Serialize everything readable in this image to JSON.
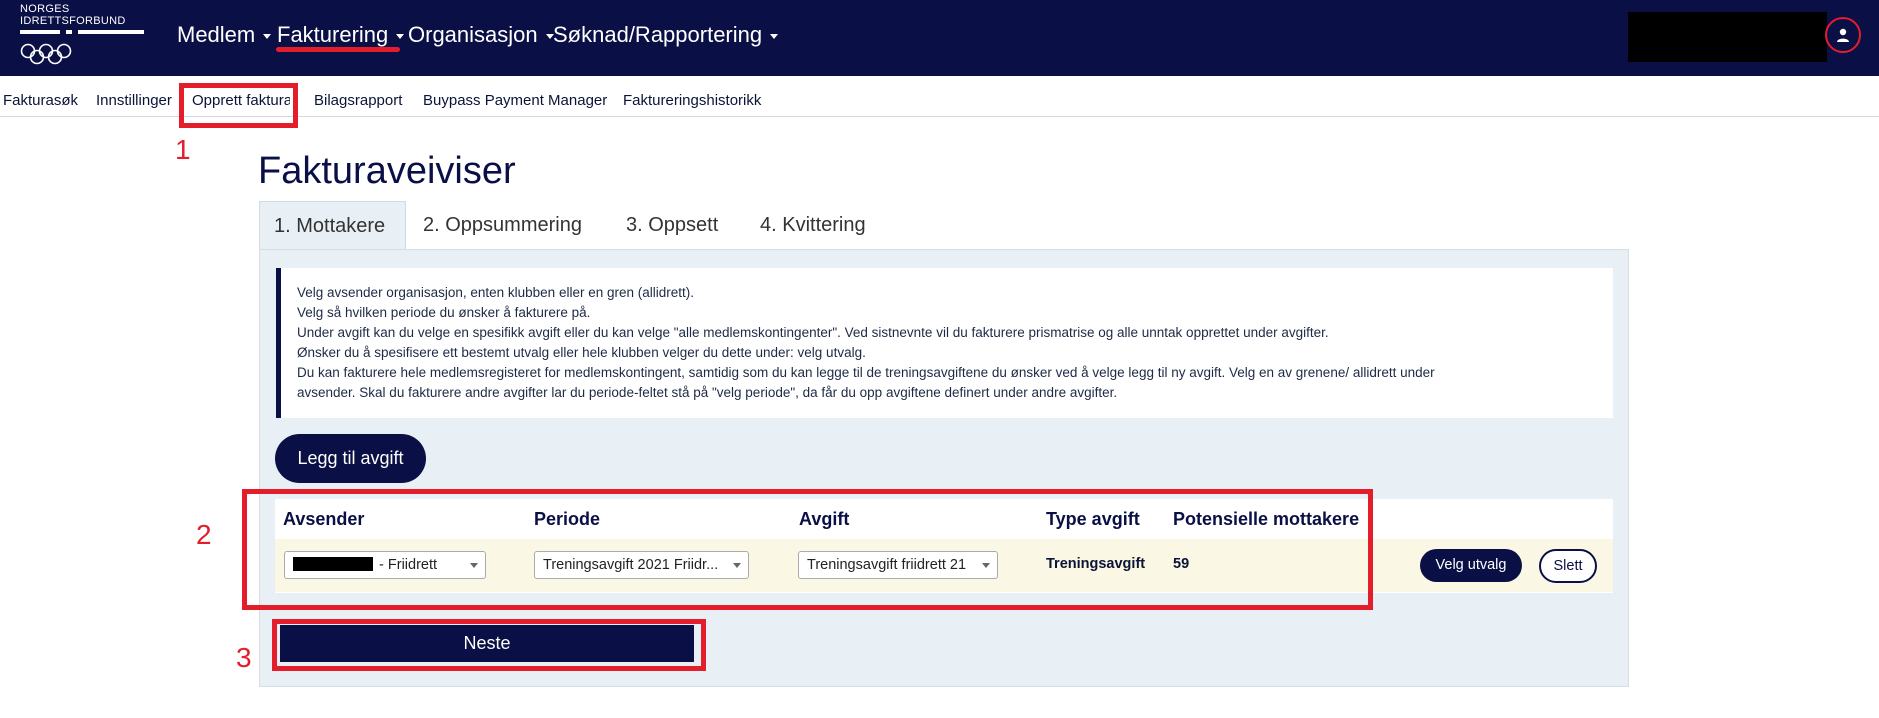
{
  "logo": {
    "text": "NORGES\nIDRETTSFORBUND"
  },
  "topnav": [
    {
      "label": "Medlem"
    },
    {
      "label": "Fakturering"
    },
    {
      "label": "Organisasjon"
    },
    {
      "label": "Søknad/Rapportering"
    }
  ],
  "subnav": [
    "Fakturasøk",
    "Innstillinger",
    "Opprett faktura",
    "Bilagsrapport",
    "Buypass Payment Manager",
    "Faktureringshistorikk"
  ],
  "annotations": [
    "1",
    "2",
    "3"
  ],
  "page_title": "Fakturaveiviser",
  "tabs": [
    "1. Mottakere",
    "2. Oppsummering",
    "3. Oppsett",
    "4. Kvittering"
  ],
  "info_lines": [
    "Velg avsender organisasjon, enten klubben eller en gren (allidrett).",
    "Velg så hvilken periode du ønsker å fakturere på.",
    "Under avgift kan du velge en spesifikk avgift eller du kan velge \"alle medlemskontingenter\". Ved sistnevnte vil du fakturere prismatrise og alle unntak opprettet under avgifter.",
    "Ønsker du å spesifisere ett bestemt utvalg eller hele klubben velger du dette under: velg utvalg.",
    "Du kan fakturere hele medlemsregisteret for medlemskontingent, samtidig som du kan legge til de treningsavgiftene du ønsker ved å velge legg til ny avgift. Velg en av grenene/ allidrett under",
    "avsender. Skal du fakturere andre avgifter lar du periode-feltet stå på \"velg periode\", da får du opp avgiftene definert under andre avgifter."
  ],
  "add_fee_button": "Legg til avgift",
  "table": {
    "headers": [
      "Avsender",
      "Periode",
      "Avgift",
      "Type avgift",
      "Potensielle mottakere"
    ],
    "row": {
      "avsender": "- Friidrett",
      "periode": "Treningsavgift 2021 Friidr...",
      "avgift": "Treningsavgift friidrett 21",
      "type": "Treningsavgift",
      "mottakere": "59",
      "velg_utvalg": "Velg utvalg",
      "slett": "Slett"
    }
  },
  "next_button": "Neste",
  "colors": {
    "navy": "#0a0f45",
    "annotation_red": "#e31e2a",
    "panel_bg": "#e8f0f5",
    "row_bg": "#fbf7e5"
  }
}
